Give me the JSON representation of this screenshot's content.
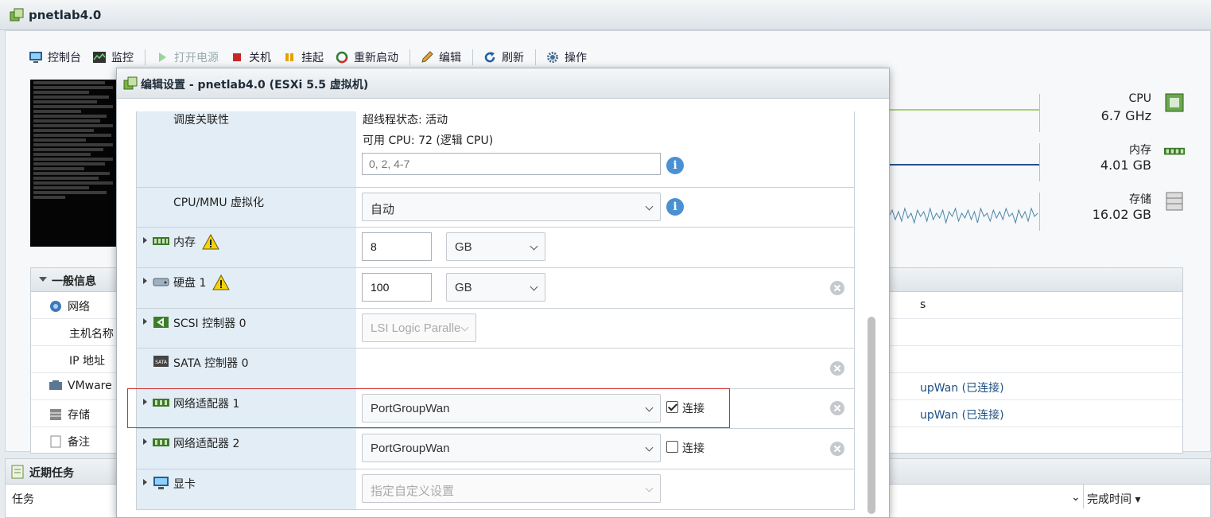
{
  "window": {
    "title": "pnetlab4.0"
  },
  "toolbar": {
    "console": "控制台",
    "monitor": "监控",
    "power_on": "打开电源",
    "power_off": "关机",
    "suspend": "挂起",
    "restart": "重新启动",
    "edit": "编辑",
    "refresh": "刷新",
    "actions": "操作"
  },
  "stats": {
    "cpu": {
      "label": "CPU",
      "value": "6.7 GHz"
    },
    "memory": {
      "label": "内存",
      "value": "4.01 GB"
    },
    "storage": {
      "label": "存储",
      "value": "16.02 GB"
    }
  },
  "general": {
    "header": "一般信息",
    "network": "网络",
    "hostname": "主机名称",
    "ip": "IP 地址",
    "vmware": "VMware",
    "storage": "存储",
    "notes": "备注",
    "col_partial": "s",
    "nic1_status": "upWan (已连接)",
    "nic2_status": "upWan (已连接)"
  },
  "tasks": {
    "header": "近期任务",
    "col_task": "任务",
    "col_complete": "完成时间 ▾"
  },
  "dialog": {
    "title": "编辑设置 - pnetlab4.0 (ESXi 5.5 虚拟机)",
    "rows": {
      "affinity": {
        "label": "调度关联性",
        "hyperthread": "超线程状态: 活动",
        "cpus": "可用 CPU: 72 (逻辑 CPU)",
        "placeholder": "0, 2, 4-7"
      },
      "mmu": {
        "label": "CPU/MMU 虚拟化",
        "value": "自动"
      },
      "memory": {
        "label": "内存",
        "value": "8",
        "unit": "GB"
      },
      "disk": {
        "label": "硬盘 1",
        "value": "100",
        "unit": "GB"
      },
      "scsi": {
        "label": "SCSI 控制器 0",
        "value": "LSI Logic Paralle"
      },
      "sata": {
        "label": "SATA 控制器 0"
      },
      "nic1": {
        "label": "网络适配器 1",
        "value": "PortGroupWan",
        "connect": "连接",
        "connected": true
      },
      "nic2": {
        "label": "网络适配器 2",
        "value": "PortGroupWan",
        "connect": "连接",
        "connected": false
      },
      "video": {
        "label": "显卡",
        "value": "指定自定义设置"
      }
    }
  }
}
